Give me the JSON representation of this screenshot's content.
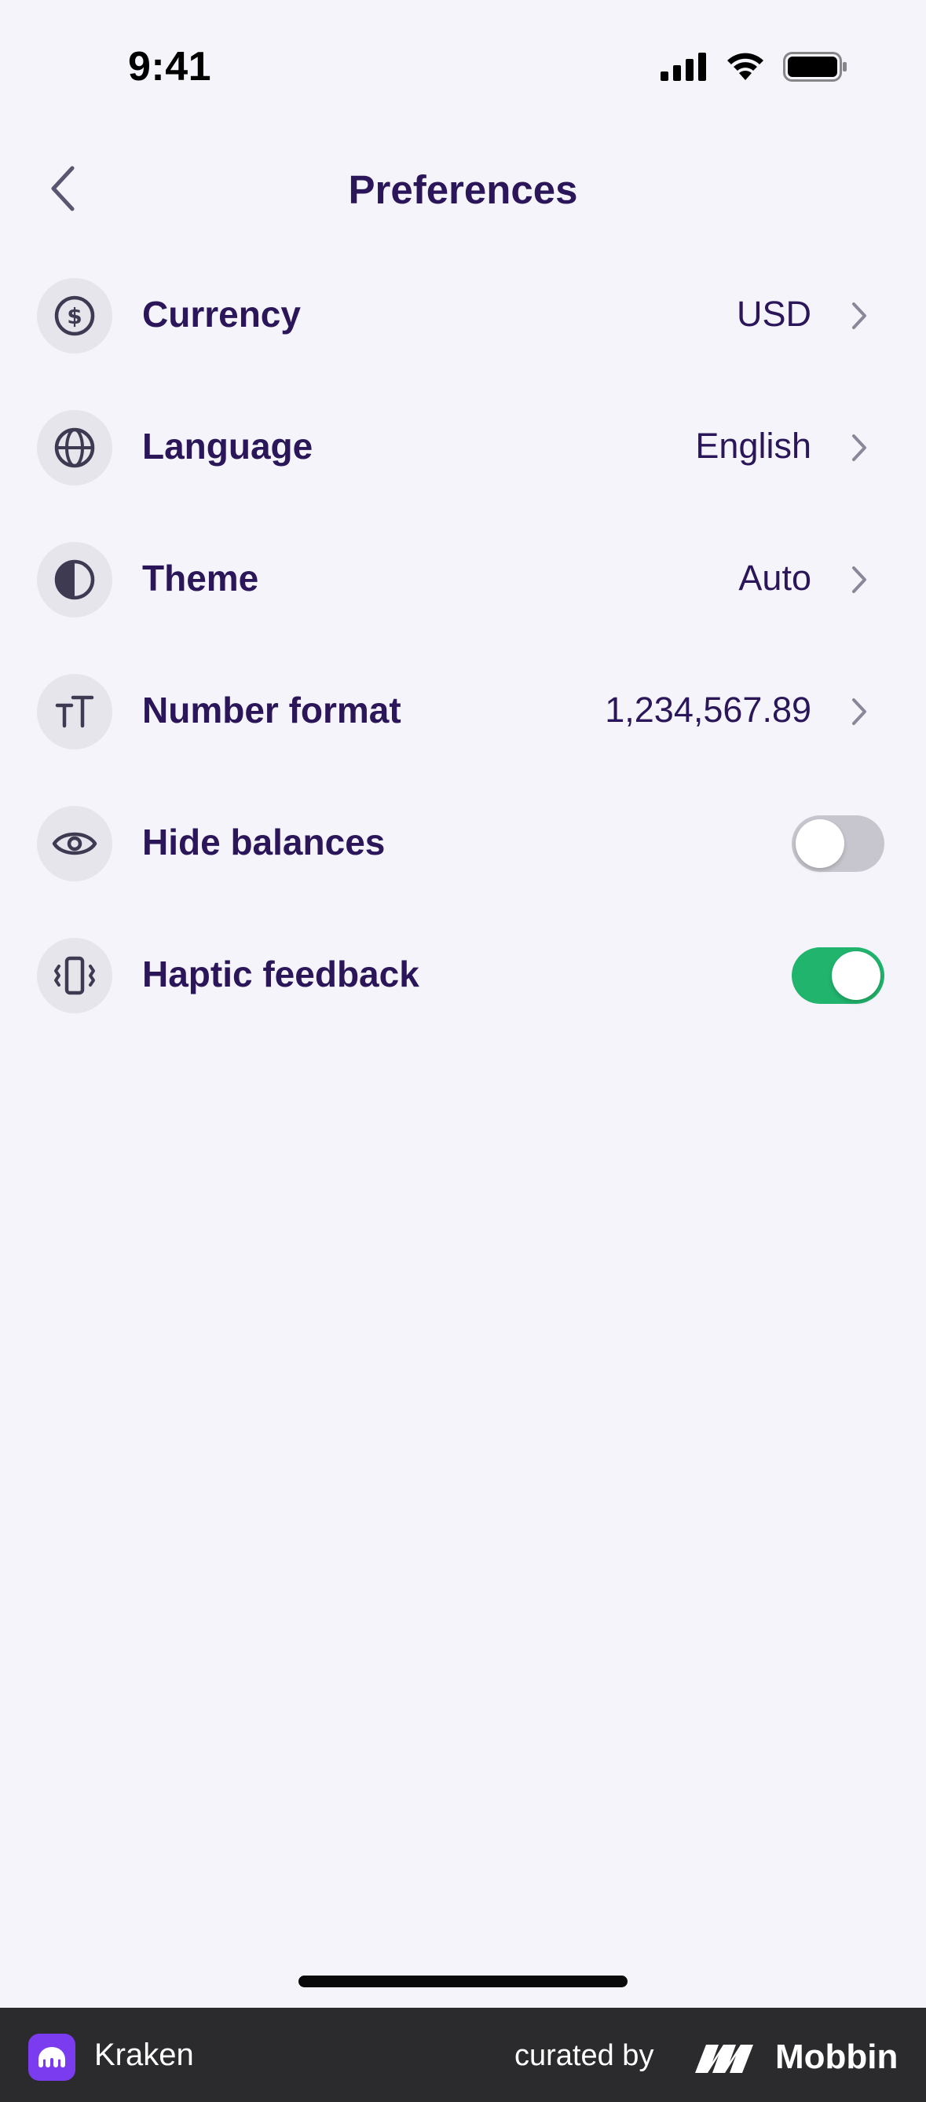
{
  "status_bar": {
    "time": "9:41"
  },
  "header": {
    "title": "Preferences"
  },
  "preferences": [
    {
      "label": "Currency",
      "value": "USD",
      "icon": "dollar-coin-icon"
    },
    {
      "label": "Language",
      "value": "English",
      "icon": "globe-icon"
    },
    {
      "label": "Theme",
      "value": "Auto",
      "icon": "half-circle-icon"
    },
    {
      "label": "Number format",
      "value": "1,234,567.89",
      "icon": "text-size-icon"
    },
    {
      "label": "Hide balances",
      "toggle": false,
      "icon": "eye-icon"
    },
    {
      "label": "Haptic feedback",
      "toggle": true,
      "icon": "phone-vibrate-icon"
    }
  ],
  "footer": {
    "app_name": "Kraken",
    "curated_by": "curated by",
    "curator": "Mobbin"
  },
  "colors": {
    "background": "#f5f4fa",
    "text_primary": "#2a1659",
    "icon_bg": "#e6e5ec",
    "toggle_on": "#21b46d",
    "toggle_off": "#c7c6ce",
    "brand_purple": "#7b3cf0"
  }
}
